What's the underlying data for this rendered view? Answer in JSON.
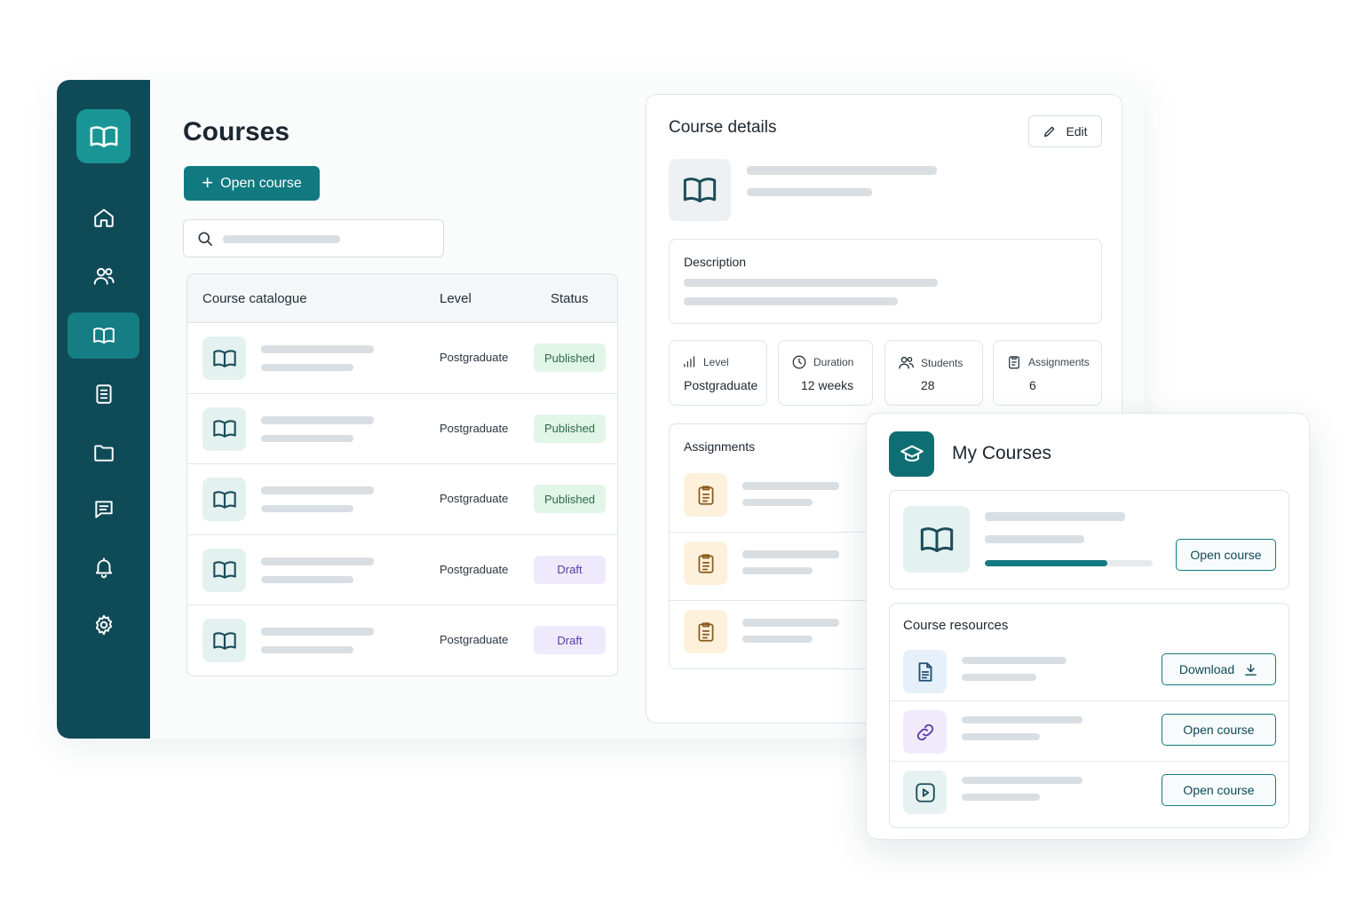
{
  "courses": {
    "title": "Courses",
    "open_course_button": "Open course",
    "search": {
      "placeholder": ""
    },
    "table": {
      "headers": {
        "name": "Course catalogue",
        "level": "Level",
        "status": "Status"
      },
      "rows": [
        {
          "level": "Postgraduate",
          "status": "Published"
        },
        {
          "level": "Postgraduate",
          "status": "Published"
        },
        {
          "level": "Postgraduate",
          "status": "Published"
        },
        {
          "level": "Postgraduate",
          "status": "Draft"
        },
        {
          "level": "Postgraduate",
          "status": "Draft"
        }
      ]
    }
  },
  "details": {
    "title": "Course details",
    "edit_button": "Edit",
    "description_label": "Description",
    "stats": [
      {
        "label": "Level",
        "value": "Postgraduate",
        "icon": "bar-chart-icon"
      },
      {
        "label": "Duration",
        "value": "12 weeks",
        "icon": "clock-icon"
      },
      {
        "label": "Students",
        "value": "28",
        "icon": "users-icon"
      },
      {
        "label": "Assignments",
        "value": "6",
        "icon": "clipboard-icon"
      }
    ],
    "assignments_label": "Assignments"
  },
  "my_courses": {
    "title": "My Courses",
    "progress": 0.73,
    "open_course_button": "Open course",
    "resources_label": "Course resources",
    "resources": [
      {
        "icon": "document-icon",
        "button": "Download"
      },
      {
        "icon": "link-icon",
        "button": "Open course"
      },
      {
        "icon": "video-icon",
        "button": "Open course"
      }
    ]
  },
  "colors": {
    "sidebar": "#0f4a57",
    "accent": "#107a80",
    "published_bg": "#e1f5e8",
    "draft_bg": "#efe9fc"
  }
}
